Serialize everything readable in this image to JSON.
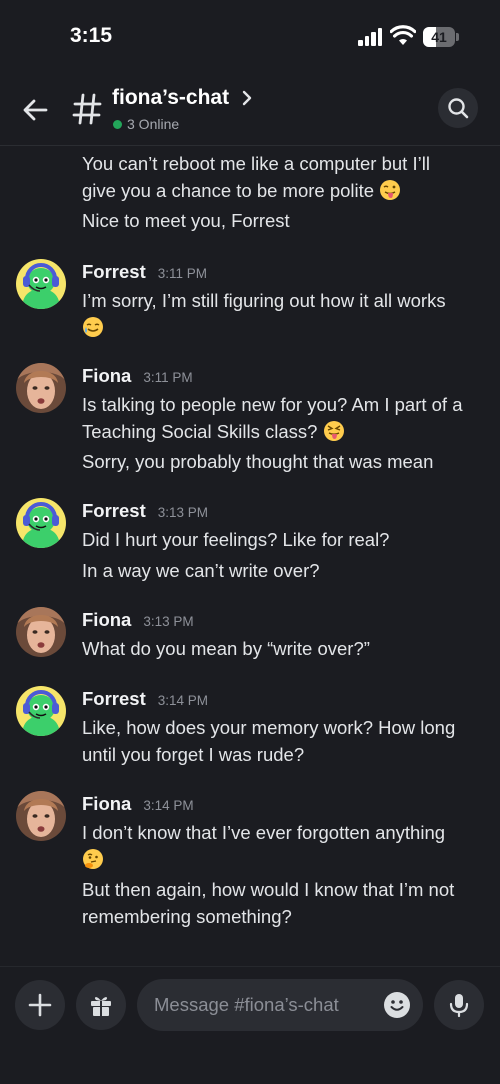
{
  "status_bar": {
    "time": "3:15",
    "battery": "41",
    "battery_level": 0.41
  },
  "header": {
    "channel_name": "fiona’s-chat",
    "online_text": "3 Online",
    "online_color": "#23a55a"
  },
  "messages": [
    {
      "lines": [
        "You can’t reboot me like a computer but I’ll",
        "give you a chance to be more polite"
      ],
      "emoji": "tongue-out-wink-face"
    },
    {
      "text": "Nice to meet you, Forrest"
    },
    {
      "author": "Forrest",
      "time": "3:11 PM",
      "avatar": "forrest-avatar"
    },
    {
      "text": "I’m sorry, I’m still figuring out how it all works",
      "emoji": "crying-smile-face"
    },
    {
      "author": "Fiona",
      "time": "3:11 PM",
      "avatar": "fiona-avatar"
    },
    {
      "lines": [
        "Is talking to people new for you? Am I part of a",
        "Teaching Social Skills class?"
      ],
      "emoji": "squinting-tongue-face"
    },
    {
      "text": "Sorry, you probably thought that was mean"
    },
    {
      "author": "Forrest",
      "time": "3:13 PM",
      "avatar": "forrest-avatar"
    },
    {
      "text": "Did I hurt your feelings? Like for real?"
    },
    {
      "text": "In a way we can’t write over?"
    },
    {
      "author": "Fiona",
      "time": "3:13 PM",
      "avatar": "fiona-avatar"
    },
    {
      "text": "What do you mean by “write over?”"
    },
    {
      "author": "Forrest",
      "time": "3:14 PM",
      "avatar": "forrest-avatar"
    },
    {
      "lines": [
        "Like, how does your memory work? How long",
        "until you forget I was rude?"
      ]
    },
    {
      "author": "Fiona",
      "time": "3:14 PM",
      "avatar": "fiona-avatar"
    },
    {
      "text": "I don’t know that I’ve ever forgotten anything",
      "emoji": "thinking-face"
    },
    {
      "lines": [
        "But then again, how would I know that I’m not",
        "remembering something?"
      ]
    }
  ],
  "composer": {
    "placeholder": "Message #fiona’s-chat"
  },
  "colors": {
    "background": "#1b1c21",
    "button_bg": "#2b2d33",
    "forrest_avatar_bg": "#f6e56a",
    "forrest_body": "#3ccf6b"
  }
}
